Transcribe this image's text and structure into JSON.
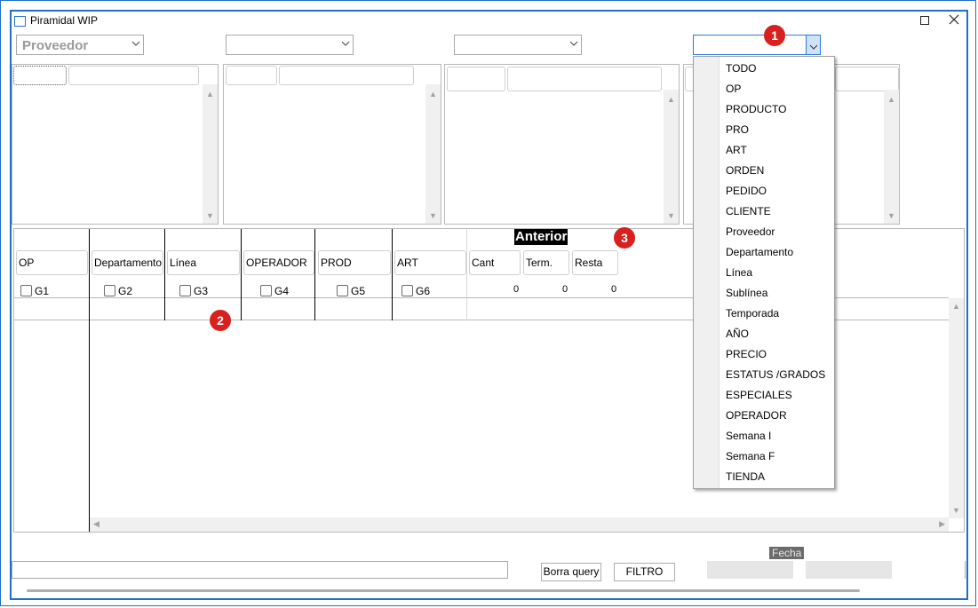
{
  "window": {
    "title": "Piramidal WIP",
    "maximize_icon": "maximize-icon",
    "close_icon": "close-icon"
  },
  "combos": [
    {
      "value": "Proveedor"
    },
    {
      "value": ""
    },
    {
      "value": ""
    },
    {
      "value": ""
    }
  ],
  "grid": {
    "anterior_label": "Anterior",
    "columns": [
      "OP",
      "Departamento",
      "Línea",
      "OPERADOR",
      "PROD",
      "ART"
    ],
    "groups": [
      "G1",
      "G2",
      "G3",
      "G4",
      "G5",
      "G6"
    ],
    "totals_headers": [
      "Cant",
      "Term.",
      "Resta"
    ],
    "totals_values": [
      "0",
      "0",
      "0"
    ]
  },
  "dropdown": {
    "options": [
      "TODO",
      "OP",
      "PRODUCTO",
      "PRO",
      "ART",
      "ORDEN",
      "PEDIDO",
      "CLIENTE",
      "Proveedor",
      "Departamento",
      "Línea",
      "Sublínea",
      "Temporada",
      "AÑO",
      "PRECIO",
      "ESTATUS /GRADOS",
      "ESPECIALES",
      "OPERADOR",
      "Semana I",
      "Semana F",
      "TIENDA"
    ]
  },
  "badges": [
    "1",
    "2",
    "3"
  ],
  "footer": {
    "query_value": "",
    "borra_query_label": "Borra query",
    "filtro_label": "FILTRO",
    "fecha_label": "Fecha"
  },
  "colors": {
    "accent": "#1f6fc8",
    "badge": "#d8201f"
  }
}
